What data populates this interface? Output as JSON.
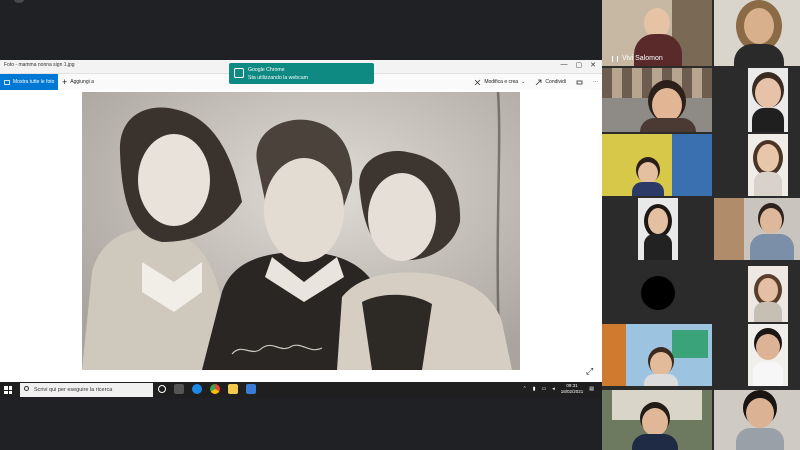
{
  "photos_app": {
    "window_title": "Foto - mamma nonna sign 1.jpg",
    "all_photos_button": "Mostra tutte le foto",
    "add_button": "Aggiungi a",
    "edit_create": "Modifica e crea",
    "share": "Condividi",
    "window_controls": [
      "—",
      "▢",
      "✕"
    ]
  },
  "notification": {
    "title": "Google Chrome",
    "message": "Sta utilizzando la webcam"
  },
  "taskbar": {
    "search_placeholder": "Scrivi qui per eseguire la ricerca",
    "time": "09:31",
    "date": "18/02/2021"
  },
  "participants": [
    {
      "name": "Vivi Salomon",
      "speaking": true
    }
  ],
  "colors": {
    "accent": "#0078d4",
    "notification_bg": "#0f8a82",
    "taskbar_bg": "#1f1f1f",
    "meet_bg": "#202124"
  }
}
